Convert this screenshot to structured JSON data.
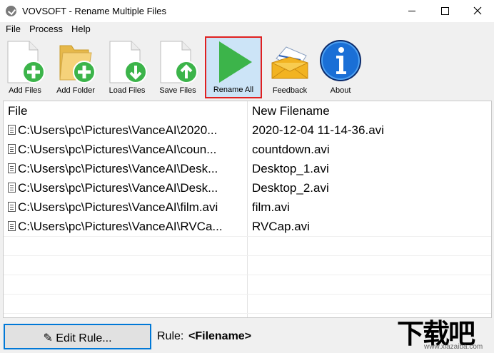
{
  "window": {
    "title": "VOVSOFT - Rename Multiple Files"
  },
  "menu": {
    "items": [
      "File",
      "Process",
      "Help"
    ]
  },
  "toolbar": {
    "buttons": [
      {
        "label": "Add Files",
        "icon": "add-file-icon"
      },
      {
        "label": "Add Folder",
        "icon": "add-folder-icon"
      },
      {
        "label": "Load Files",
        "icon": "load-files-icon"
      },
      {
        "label": "Save Files",
        "icon": "save-files-icon"
      },
      {
        "label": "Rename All",
        "icon": "play-icon"
      },
      {
        "label": "Feedback",
        "icon": "envelope-icon"
      },
      {
        "label": "About",
        "icon": "info-icon"
      }
    ]
  },
  "list": {
    "columns": [
      "File",
      "New Filename"
    ],
    "rows": [
      {
        "file": "C:\\Users\\pc\\Pictures\\VanceAI\\2020...",
        "new": "2020-12-04 11-14-36.avi"
      },
      {
        "file": "C:\\Users\\pc\\Pictures\\VanceAI\\coun...",
        "new": "countdown.avi"
      },
      {
        "file": "C:\\Users\\pc\\Pictures\\VanceAI\\Desk...",
        "new": "Desktop_1.avi"
      },
      {
        "file": "C:\\Users\\pc\\Pictures\\VanceAI\\Desk...",
        "new": "Desktop_2.avi"
      },
      {
        "file": "C:\\Users\\pc\\Pictures\\VanceAI\\film.avi",
        "new": "film.avi"
      },
      {
        "file": "C:\\Users\\pc\\Pictures\\VanceAI\\RVCa...",
        "new": "RVCap.avi"
      }
    ]
  },
  "bottom": {
    "edit_button": "✎ Edit Rule...",
    "rule_label": "Rule:",
    "rule_value": "<Filename>"
  },
  "watermark": {
    "text": "下载吧",
    "url": "www.xiazaiba.com"
  },
  "colors": {
    "highlight_border": "#e02020",
    "accent_blue": "#0078d7",
    "green_icon": "#3cb44a"
  }
}
